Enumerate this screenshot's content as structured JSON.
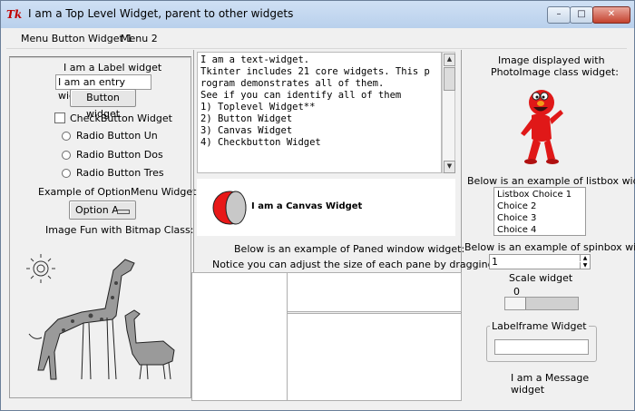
{
  "window": {
    "title": "I am a Top Level Widget, parent to other widgets",
    "logo": "Tk",
    "controls": [
      "minimize-icon",
      "maximize-icon",
      "close-icon"
    ]
  },
  "menubar": {
    "items": [
      "Menu Button Widget 1",
      "Menu 2"
    ]
  },
  "left": {
    "label": "I am a Label widget",
    "entry_value": "I am an entry widget",
    "button_label": "Button widget",
    "checkbutton_label": "CheckButton Widget",
    "radios": [
      "Radio Button  Un",
      "Radio Button  Dos",
      "Radio Button  Tres"
    ],
    "optionmenu_caption": "Example of OptionMenu Widget:",
    "optionmenu_value": "Option A",
    "bitmap_caption": "Image Fun with Bitmap Class:"
  },
  "center": {
    "text_lines": [
      "I am a text-widget.",
      "Tkinter includes 21 core widgets. This p",
      "rogram demonstrates all of them.",
      "",
      "See if you can identify all of them",
      "",
      "1) Toplevel Widget**",
      "2) Button Widget",
      "3) Canvas Widget",
      "4) Checkbutton Widget"
    ],
    "canvas_label": "I am a Canvas Widget",
    "paned_caption_1": "Below is an example of Paned window widget:",
    "paned_caption_2": "Notice you can adjust the size of each pane by dragging it"
  },
  "right": {
    "photo_caption_1": "Image displayed with",
    "photo_caption_2": "PhotoImage class widget:",
    "listbox_caption": "Below is an example of listbox widget:",
    "listbox_items": [
      "Listbox Choice 1",
      "Choice 2",
      "Choice 3",
      "Choice 4"
    ],
    "spinbox_caption": "Below is an example of spinbox widget:",
    "spinbox_value": "1",
    "scale_caption": "Scale widget",
    "scale_value": "0",
    "labelframe_title": "Labelframe Widget",
    "message_line_1": "I am a Message",
    "message_line_2": "widget"
  },
  "colors": {
    "canvas_oval_fill": "#e81818",
    "elmo_red": "#e01818",
    "titlebar": "#c4d8f0"
  }
}
